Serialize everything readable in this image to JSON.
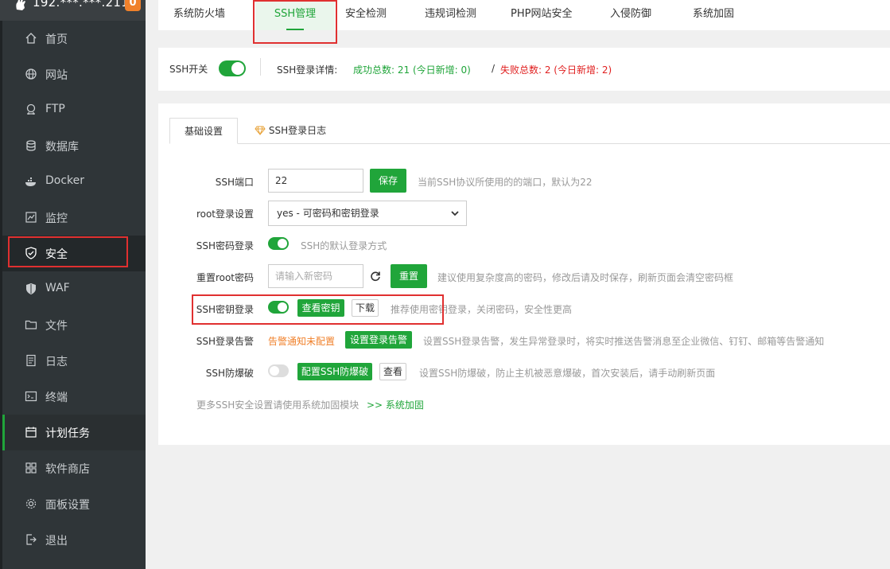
{
  "sidebar": {
    "server_name": "192.***.***.211",
    "badge": "0",
    "items": [
      {
        "label": "首页",
        "icon": "home-icon"
      },
      {
        "label": "网站",
        "icon": "globe-icon"
      },
      {
        "label": "FTP",
        "icon": "ftp-icon"
      },
      {
        "label": "数据库",
        "icon": "database-icon"
      },
      {
        "label": "Docker",
        "icon": "docker-icon"
      },
      {
        "label": "监控",
        "icon": "monitor-icon"
      },
      {
        "label": "安全",
        "icon": "shield-check-icon"
      },
      {
        "label": "WAF",
        "icon": "waf-shield-icon"
      },
      {
        "label": "文件",
        "icon": "folder-icon"
      },
      {
        "label": "日志",
        "icon": "log-icon"
      },
      {
        "label": "终端",
        "icon": "terminal-icon"
      },
      {
        "label": "计划任务",
        "icon": "calendar-icon"
      },
      {
        "label": "软件商店",
        "icon": "apps-icon"
      },
      {
        "label": "面板设置",
        "icon": "gear-icon"
      },
      {
        "label": "退出",
        "icon": "logout-icon"
      }
    ]
  },
  "top_tabs": [
    "系统防火墙",
    "SSH管理",
    "安全检测",
    "违规词检测",
    "PHP网站安全",
    "入侵防御",
    "系统加固"
  ],
  "ssh_status": {
    "switch_label": "SSH开关",
    "switch_on": true,
    "detail_label": "SSH登录详情:",
    "success_text": "成功总数: 21 (今日新增: 0)",
    "separator": "/",
    "fail_text": "失败总数: 2 (今日新增: 2)"
  },
  "inner_tabs": {
    "basic": "基础设置",
    "log": "SSH登录日志"
  },
  "form": {
    "port_label": "SSH端口",
    "port_value": "22",
    "save_label": "保存",
    "port_desc": "当前SSH协议所使用的的端口，默认为22",
    "root_label": "root登录设置",
    "root_value": "yes - 可密码和密钥登录",
    "pwd_login_label": "SSH密码登录",
    "pwd_login_on": true,
    "pwd_login_desc": "SSH的默认登录方式",
    "reset_label": "重置root密码",
    "reset_placeholder": "请输入新密码",
    "reset_btn": "重置",
    "reset_desc": "建议使用复杂度高的密码，修改后请及时保存，刷新页面会清空密码框",
    "key_label": "SSH密钥登录",
    "key_on": true,
    "view_key_btn": "查看密钥",
    "download_btn": "下载",
    "key_desc": "推荐使用密钥登录，关闭密码，安全性更高",
    "alert_label": "SSH登录告警",
    "alert_status": "告警通知未配置",
    "alert_btn": "设置登录告警",
    "alert_desc": "设置SSH登录告警，发生异常登录时，将实时推送告警消息至企业微信、钉钉、邮箱等告警通知",
    "brute_label": "SSH防爆破",
    "brute_on": false,
    "brute_btn": "配置SSH防爆破",
    "brute_view_btn": "查看",
    "brute_desc": "设置SSH防爆破，防止主机被恶意爆破，首次安装后，请手动刷新页面",
    "more_text": "更多SSH安全设置请使用系统加固模块",
    "more_link": ">> 系统加固"
  },
  "colors": {
    "accent": "#20a53a",
    "sidebar_bg": "#2f3538",
    "badge": "#f0812b",
    "fail": "#e02020",
    "highlight_box": "#e03030"
  }
}
